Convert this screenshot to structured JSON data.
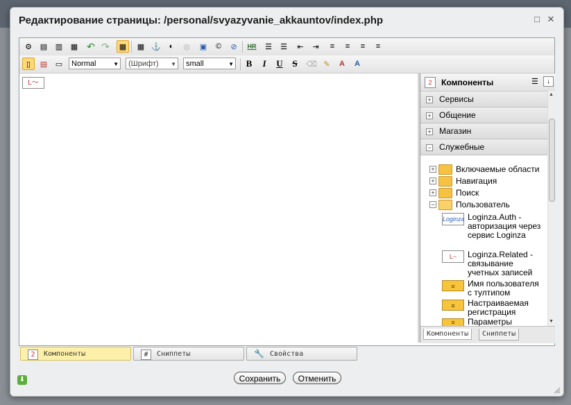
{
  "dialog": {
    "title": "Редактирование страницы: /personal/svyazyvanie_akkauntov/index.php",
    "maximize_icon": "maximize-icon",
    "close_icon": "close-icon"
  },
  "toolbar": {
    "format_select": "Normal",
    "font_select": "(Шрифт)",
    "size_select": "small",
    "bold_label": "B",
    "italic_label": "I",
    "underline_label": "U",
    "strike_label": "S",
    "copyright_label": "©",
    "hr_label": "HR"
  },
  "panel": {
    "title": "Компоненты",
    "groups": [
      {
        "label": "Сервисы",
        "state": "+"
      },
      {
        "label": "Общение",
        "state": "+"
      },
      {
        "label": "Магазин",
        "state": "+"
      },
      {
        "label": "Служебные",
        "state": "−"
      }
    ],
    "folders": [
      {
        "label": "Включаемые области",
        "state": "+"
      },
      {
        "label": "Навигация",
        "state": "+"
      },
      {
        "label": "Поиск",
        "state": "+"
      },
      {
        "label": "Пользователь",
        "state": "−"
      }
    ],
    "components": [
      {
        "label": "Loginza.Auth - авторизация через сервис Loginza",
        "icon_text": "Loginza"
      },
      {
        "label": "Loginza.Related - связывание учетных записей",
        "icon_text": "L~"
      },
      {
        "label": "Имя пользователя с тултипом",
        "icon_text": "≡"
      },
      {
        "label": "Настраиваемая регистрация",
        "icon_text": "≡"
      },
      {
        "label": "Параметры",
        "icon_text": "≡"
      }
    ],
    "tabs": [
      "Компоненты",
      "Сниппеты"
    ]
  },
  "bottom_tabs": [
    {
      "label": "Компоненты",
      "icon": "components-icon"
    },
    {
      "label": "Сниппеты",
      "icon": "snippets-icon"
    },
    {
      "label": "Свойства",
      "icon": "wrench-icon"
    }
  ],
  "footer": {
    "save": "Сохранить",
    "cancel": "Отменить"
  }
}
